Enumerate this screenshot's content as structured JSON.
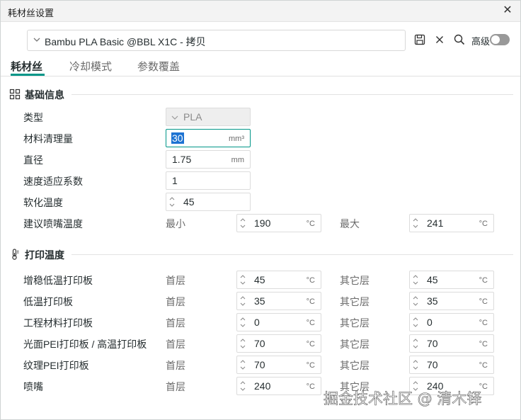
{
  "window": {
    "title": "耗材丝设置"
  },
  "preset": {
    "value": "Bambu PLA Basic @BBL X1C - 拷贝"
  },
  "toolbar": {
    "advanced_label": "高级",
    "advanced_on": false
  },
  "tabs": [
    {
      "label": "耗材丝",
      "active": true
    },
    {
      "label": "冷却模式",
      "active": false
    },
    {
      "label": "参数覆盖",
      "active": false
    }
  ],
  "basic": {
    "title": "基础信息",
    "type": {
      "label": "类型",
      "value": "PLA"
    },
    "flush": {
      "label": "材料清理量",
      "value": "30",
      "unit": "mm³"
    },
    "diameter": {
      "label": "直径",
      "value": "1.75",
      "unit": "mm"
    },
    "flow": {
      "label": "速度适应系数",
      "value": "1"
    },
    "soften": {
      "label": "软化温度",
      "value": "45"
    },
    "nozzle_temp": {
      "label": "建议喷嘴温度",
      "min_label": "最小",
      "min_value": "190",
      "max_label": "最大",
      "max_value": "241",
      "unit": "°C"
    }
  },
  "print_temp": {
    "title": "打印温度",
    "first_label": "首层",
    "other_label": "其它层",
    "unit": "°C",
    "rows": [
      {
        "label": "增稳低温打印板",
        "first": "45",
        "other": "45"
      },
      {
        "label": "低温打印板",
        "first": "35",
        "other": "35"
      },
      {
        "label": "工程材料打印板",
        "first": "0",
        "other": "0"
      },
      {
        "label": "光面PEI打印板 / 高温打印板",
        "first": "70",
        "other": "70"
      },
      {
        "label": "纹理PEI打印板",
        "first": "70",
        "other": "70"
      },
      {
        "label": "喷嘴",
        "first": "240",
        "other": "240"
      }
    ]
  }
}
